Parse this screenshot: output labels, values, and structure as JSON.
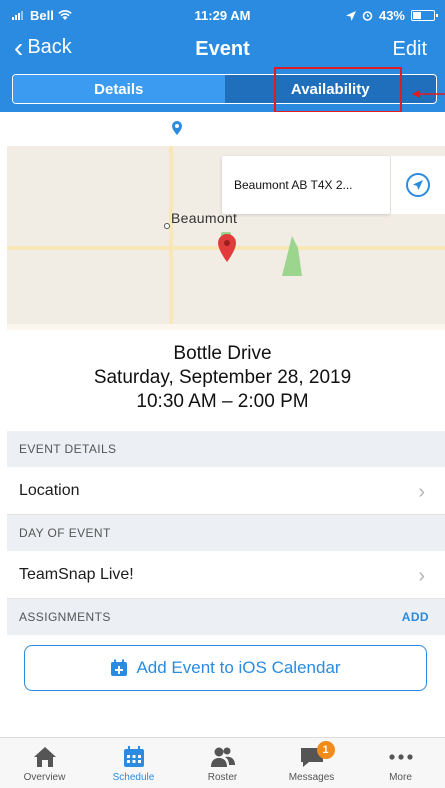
{
  "status_bar": {
    "carrier": "Bell",
    "time": "11:29 AM",
    "battery": "43%",
    "battery_level": 0.43
  },
  "nav": {
    "back_label": "Back",
    "title": "Event",
    "edit_label": "Edit"
  },
  "segments": [
    {
      "label": "Details",
      "active": true
    },
    {
      "label": "Availability",
      "active": false
    }
  ],
  "map": {
    "callout_address": "Beaumont AB T4X 2...",
    "town_label": "Beaumont"
  },
  "event": {
    "name": "Bottle Drive",
    "date": "Saturday, September 28, 2019",
    "time": "10:30 AM – 2:00 PM"
  },
  "sections": {
    "event_details": "EVENT DETAILS",
    "location_row": "Location",
    "day_of_event": "DAY OF EVENT",
    "teamsnap_live_row": "TeamSnap Live!",
    "assignments": "ASSIGNMENTS",
    "assignments_add": "ADD"
  },
  "calendar_button": "Add Event to iOS Calendar",
  "tabbar": [
    {
      "label": "Overview",
      "icon": "home-icon",
      "active": false
    },
    {
      "label": "Schedule",
      "icon": "calendar-icon",
      "active": true
    },
    {
      "label": "Roster",
      "icon": "people-icon",
      "active": false
    },
    {
      "label": "Messages",
      "icon": "chat-bubble-icon",
      "active": false,
      "badge": "1"
    },
    {
      "label": "More",
      "icon": "more-dots-icon",
      "active": false
    }
  ],
  "colors": {
    "brand_blue": "#2a8be0",
    "annotation_red": "#e01b22",
    "badge_orange": "#f08b1c"
  }
}
